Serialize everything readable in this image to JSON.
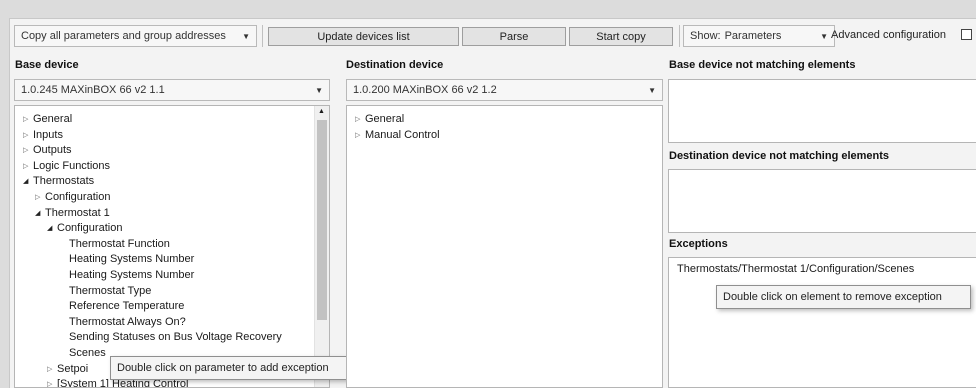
{
  "toolbar": {
    "copy_mode": "Copy all parameters and group addresses",
    "update_button": "Update devices list",
    "parse_button": "Parse",
    "start_copy_button": "Start copy",
    "show_label": "Show:",
    "show_value": "Parameters",
    "advanced_label": "Advanced configuration",
    "advanced_checked": false
  },
  "base": {
    "title": "Base device",
    "device": "1.0.245  MAXinBOX 66 v2 1.1",
    "tree": [
      {
        "label": "General",
        "level": 0,
        "expander": "collapsed"
      },
      {
        "label": "Inputs",
        "level": 0,
        "expander": "collapsed"
      },
      {
        "label": "Outputs",
        "level": 0,
        "expander": "collapsed"
      },
      {
        "label": "Logic Functions",
        "level": 0,
        "expander": "collapsed"
      },
      {
        "label": "Thermostats",
        "level": 0,
        "expander": "expanded"
      },
      {
        "label": "Configuration",
        "level": 1,
        "expander": "collapsed"
      },
      {
        "label": "Thermostat 1",
        "level": 1,
        "expander": "expanded"
      },
      {
        "label": "Configuration",
        "level": 2,
        "expander": "expanded"
      },
      {
        "label": "Thermostat Function",
        "level": 3,
        "expander": "none"
      },
      {
        "label": "Heating Systems Number",
        "level": 3,
        "expander": "none"
      },
      {
        "label": "Heating Systems Number",
        "level": 3,
        "expander": "none"
      },
      {
        "label": "Thermostat Type",
        "level": 3,
        "expander": "none"
      },
      {
        "label": "Reference Temperature",
        "level": 3,
        "expander": "none"
      },
      {
        "label": "Thermostat Always On?",
        "level": 3,
        "expander": "none"
      },
      {
        "label": "Sending Statuses on Bus Voltage Recovery",
        "level": 3,
        "expander": "none"
      },
      {
        "label": "Scenes",
        "level": 3,
        "expander": "none"
      },
      {
        "label": "Setpoi",
        "level": 2,
        "expander": "collapsed"
      },
      {
        "label": "[System 1] Heating Control",
        "level": 2,
        "expander": "collapsed"
      }
    ],
    "tooltip": "Double click on parameter to add exception"
  },
  "destination": {
    "title": "Destination device",
    "device": "1.0.200  MAXinBOX 66 v2 1.2",
    "tree": [
      {
        "label": "General",
        "level": 0,
        "expander": "collapsed"
      },
      {
        "label": "Manual Control",
        "level": 0,
        "expander": "collapsed"
      }
    ]
  },
  "right": {
    "base_not_matching_title": "Base device not matching elements",
    "dest_not_matching_title": "Destination device not matching elements",
    "exceptions_title": "Exceptions",
    "exceptions": [
      "Thermostats/Thermostat 1/Configuration/Scenes"
    ],
    "tooltip": "Double click on element to remove exception"
  }
}
